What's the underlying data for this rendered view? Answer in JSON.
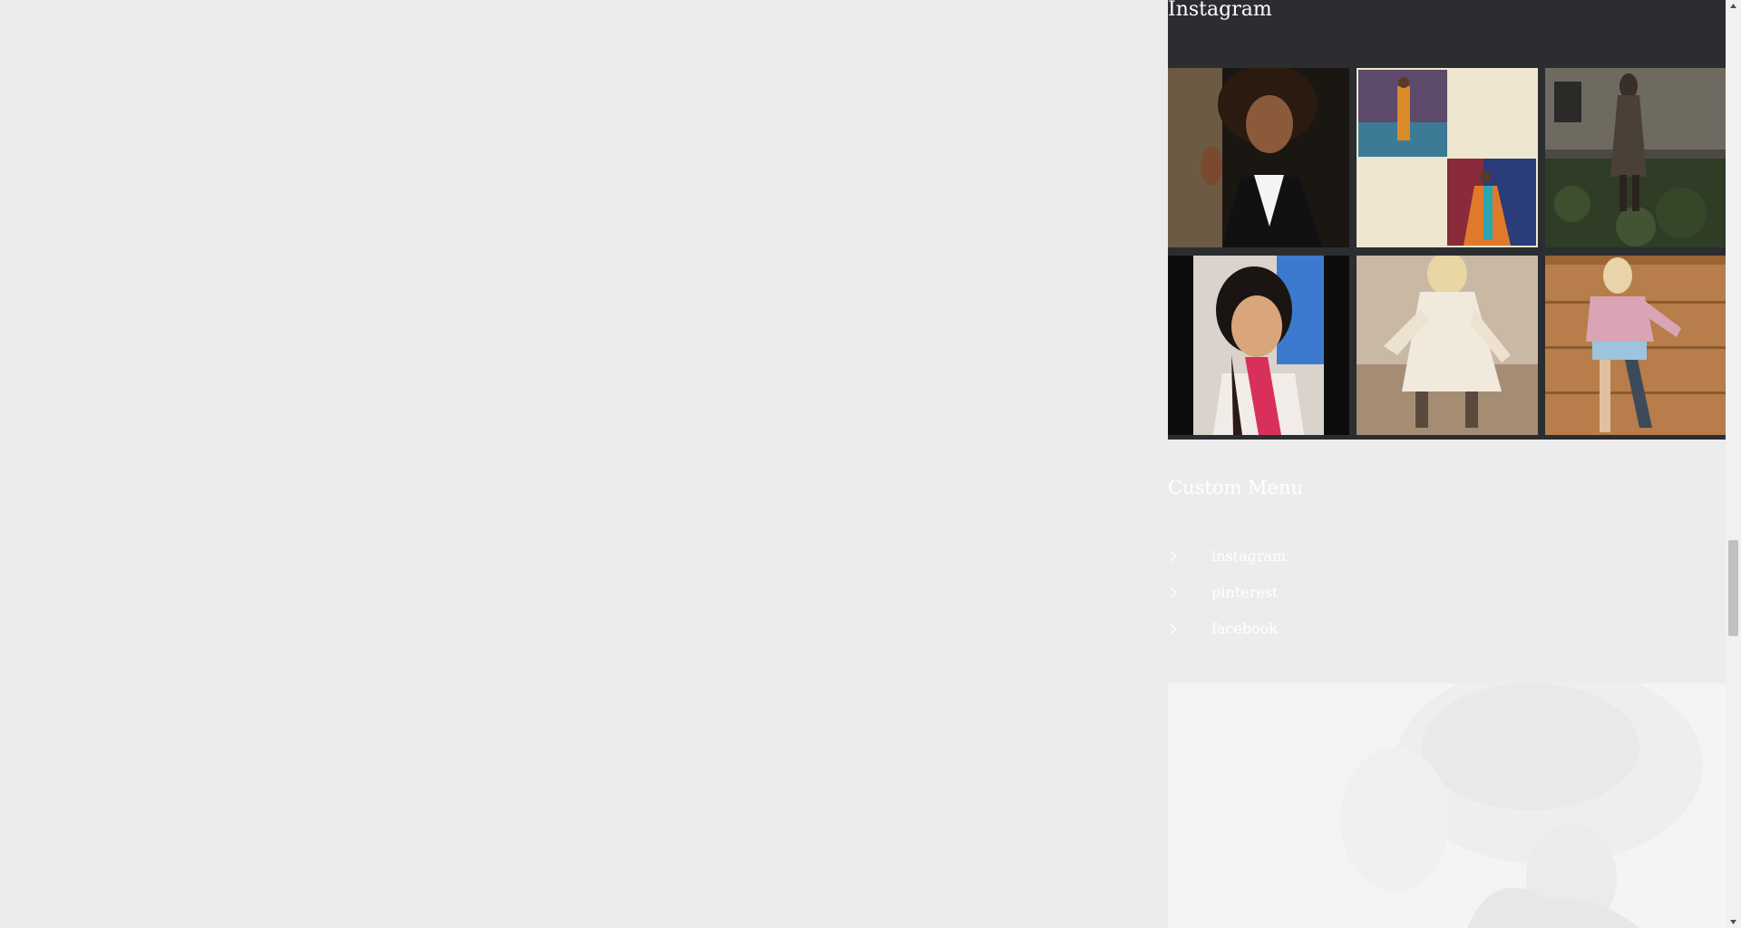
{
  "instagram": {
    "title": "Instagram",
    "photos": [
      {
        "name": "Woman with curly hair in black blazer"
      },
      {
        "name": "Runway collage"
      },
      {
        "name": "Model in overgrown courtyard"
      },
      {
        "name": "Girl with pink scarf"
      },
      {
        "name": "Woman in white lace dress"
      },
      {
        "name": "Woman in pink top against wooden fence"
      }
    ]
  },
  "custom_menu": {
    "title": "Custom Menu",
    "items": [
      {
        "label": "instagram",
        "icon": "chevron-right-icon"
      },
      {
        "label": "pinterest",
        "icon": "chevron-right-icon"
      },
      {
        "label": "facebook",
        "icon": "chevron-right-icon"
      }
    ]
  },
  "colors": {
    "page_background": "#ececec",
    "instagram_panel": "#2b2d30",
    "text": "#ffffff"
  }
}
